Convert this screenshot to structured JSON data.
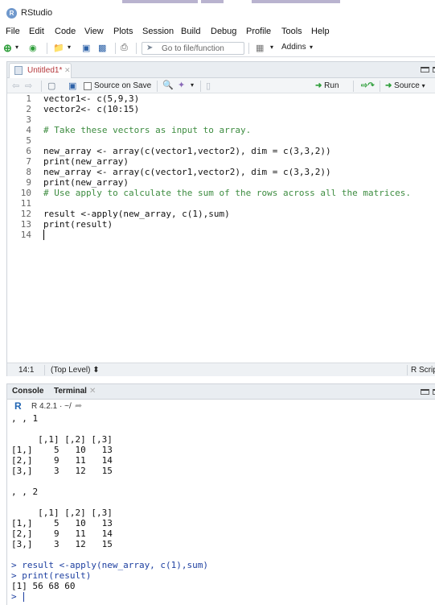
{
  "window": {
    "title": "RStudio",
    "logo_letter": "R"
  },
  "menu": [
    "File",
    "Edit",
    "Code",
    "View",
    "Plots",
    "Session",
    "Build",
    "Debug",
    "Profile",
    "Tools",
    "Help"
  ],
  "toolbar": {
    "goto_placeholder": "Go to file/function",
    "addins_label": "Addins"
  },
  "editor": {
    "tab_name": "Untitled1*",
    "source_on_save_label": "Source on Save",
    "run_label": "Run",
    "source_label": "Source",
    "lines": [
      {
        "n": "1",
        "text": "vector1<- c(5,9,3)",
        "comment": false
      },
      {
        "n": "2",
        "text": "vector2<- c(10:15)",
        "comment": false
      },
      {
        "n": "3",
        "text": "",
        "comment": false
      },
      {
        "n": "4",
        "text": "# Take these vectors as input to array.",
        "comment": true
      },
      {
        "n": "5",
        "text": "",
        "comment": false
      },
      {
        "n": "6",
        "text": "new_array <- array(c(vector1,vector2), dim = c(3,3,2))",
        "comment": false
      },
      {
        "n": "7",
        "text": "print(new_array)",
        "comment": false
      },
      {
        "n": "8",
        "text": "new_array <- array(c(vector1,vector2), dim = c(3,3,2))",
        "comment": false
      },
      {
        "n": "9",
        "text": "print(new_array)",
        "comment": false
      },
      {
        "n": "10",
        "text": "# Use apply to calculate the sum of the rows across all the matrices.",
        "comment": true
      },
      {
        "n": "11",
        "text": "",
        "comment": false
      },
      {
        "n": "12",
        "text": "result <-apply(new_array, c(1),sum)",
        "comment": false
      },
      {
        "n": "13",
        "text": "print(result)",
        "comment": false
      },
      {
        "n": "14",
        "text": "",
        "comment": false
      }
    ],
    "status": {
      "position": "14:1",
      "scope": "(Top Level) ⬍",
      "file_type": "R Script"
    }
  },
  "console": {
    "tab_console": "Console",
    "tab_terminal": "Terminal",
    "r_version_path": "R 4.2.1 · ~/",
    "output": [
      {
        "text": ", , 1",
        "cmd": false
      },
      {
        "text": "",
        "cmd": false
      },
      {
        "text": "     [,1] [,2] [,3]",
        "cmd": false
      },
      {
        "text": "[1,]    5   10   13",
        "cmd": false
      },
      {
        "text": "[2,]    9   11   14",
        "cmd": false
      },
      {
        "text": "[3,]    3   12   15",
        "cmd": false
      },
      {
        "text": "",
        "cmd": false
      },
      {
        "text": ", , 2",
        "cmd": false
      },
      {
        "text": "",
        "cmd": false
      },
      {
        "text": "     [,1] [,2] [,3]",
        "cmd": false
      },
      {
        "text": "[1,]    5   10   13",
        "cmd": false
      },
      {
        "text": "[2,]    9   11   14",
        "cmd": false
      },
      {
        "text": "[3,]    3   12   15",
        "cmd": false
      },
      {
        "text": "",
        "cmd": false
      },
      {
        "text": "> result <-apply(new_array, c(1),sum)",
        "cmd": true
      },
      {
        "text": "> print(result)",
        "cmd": true
      },
      {
        "text": "[1] 56 68 60",
        "cmd": false
      },
      {
        "text": ">",
        "cmd": true
      }
    ]
  },
  "colors": {
    "accent_blue": "#2165b3",
    "comment_green": "#3d8c40",
    "modified_tab_red": "#b5373b",
    "command_blue": "#1d3fa0"
  }
}
